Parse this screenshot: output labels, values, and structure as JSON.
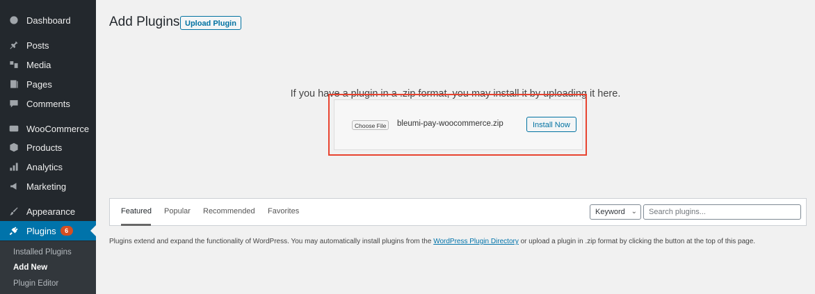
{
  "sidebar": {
    "items": [
      {
        "label": "Dashboard",
        "icon": "dashboard-icon"
      },
      {
        "label": "Posts",
        "icon": "pin-icon"
      },
      {
        "label": "Media",
        "icon": "media-icon"
      },
      {
        "label": "Pages",
        "icon": "pages-icon"
      },
      {
        "label": "Comments",
        "icon": "comment-icon"
      },
      {
        "label": "WooCommerce",
        "icon": "woo-icon"
      },
      {
        "label": "Products",
        "icon": "archive-icon"
      },
      {
        "label": "Analytics",
        "icon": "bar-chart-icon"
      },
      {
        "label": "Marketing",
        "icon": "megaphone-icon"
      },
      {
        "label": "Appearance",
        "icon": "brush-icon"
      },
      {
        "label": "Plugins",
        "icon": "plugin-icon",
        "badge": "6"
      }
    ],
    "submenu": [
      "Installed Plugins",
      "Add New",
      "Plugin Editor"
    ]
  },
  "header": {
    "title": "Add Plugins",
    "upload_button": "Upload Plugin"
  },
  "upload": {
    "intro": "If you have a plugin in a .zip format, you may install it by uploading it here.",
    "choose_file": "Choose File",
    "file_name": "bleumi-pay-woocommerce.zip",
    "install_button": "Install Now"
  },
  "filter": {
    "tabs": [
      "Featured",
      "Popular",
      "Recommended",
      "Favorites"
    ],
    "keyword": "Keyword",
    "search_placeholder": "Search plugins..."
  },
  "description": {
    "before": "Plugins extend and expand the functionality of WordPress. You may automatically install plugins from the ",
    "link": "WordPress Plugin Directory",
    "after": " or upload a plugin in .zip format by clicking the button at the top of this page."
  },
  "colors": {
    "sidebar_bg": "#23282d",
    "active_bg": "#0073aa",
    "highlight_frame": "#e8432f",
    "badge": "#d54e21"
  }
}
